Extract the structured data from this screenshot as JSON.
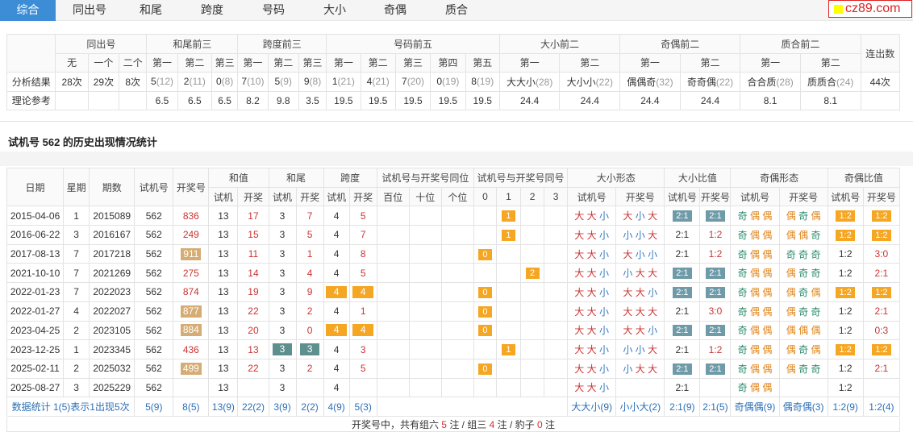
{
  "tabs": [
    "综合",
    "同出号",
    "和尾",
    "跨度",
    "号码",
    "大小",
    "奇偶",
    "质合"
  ],
  "logo": "cz89.com",
  "summary": {
    "groups": [
      "同出号",
      "和尾前三",
      "跨度前三",
      "号码前五",
      "大小前二",
      "奇偶前二",
      "质合前二",
      "连出数"
    ],
    "sub": [
      "无",
      "一个",
      "二个",
      "第一",
      "第二",
      "第三",
      "第一",
      "第二",
      "第三",
      "第一",
      "第二",
      "第三",
      "第四",
      "第五",
      "第一",
      "第二",
      "第一",
      "第二",
      "第一",
      "第二"
    ],
    "row1_label": "分析结果",
    "row1": [
      [
        "28次",
        ""
      ],
      [
        "29次",
        ""
      ],
      [
        "8次",
        ""
      ],
      [
        "5",
        "(12)"
      ],
      [
        "2",
        "(11)"
      ],
      [
        "0",
        "(8)"
      ],
      [
        "7",
        "(10)"
      ],
      [
        "5",
        "(9)"
      ],
      [
        "9",
        "(8)"
      ],
      [
        "1",
        "(21)"
      ],
      [
        "4",
        "(21)"
      ],
      [
        "7",
        "(20)"
      ],
      [
        "0",
        "(19)"
      ],
      [
        "8",
        "(19)"
      ],
      [
        "大大小",
        "(28)"
      ],
      [
        "大小小",
        "(22)"
      ],
      [
        "偶偶奇",
        "(32)"
      ],
      [
        "奇奇偶",
        "(22)"
      ],
      [
        "合合质",
        "(28)"
      ],
      [
        "质质合",
        "(24)"
      ],
      [
        "44次",
        ""
      ]
    ],
    "row2_label": "理论参考",
    "row2": [
      "",
      "",
      "",
      "6.5",
      "6.5",
      "6.5",
      "8.2",
      "9.8",
      "3.5",
      "19.5",
      "19.5",
      "19.5",
      "19.5",
      "19.5",
      "24.4",
      "24.4",
      "24.4",
      "24.4",
      "8.1",
      "8.1",
      ""
    ]
  },
  "section_title": "试机号 562 的历史出现情况统计",
  "hist": {
    "h_date": "日期",
    "h_week": "星期",
    "h_issue": "期数",
    "h_test": "试机号",
    "h_draw": "开奖号",
    "groups": [
      "和值",
      "和尾",
      "跨度",
      "试机号与开奖号同位",
      "试机号与开奖号同号",
      "大小形态",
      "大小比值",
      "奇偶形态",
      "奇偶比值"
    ],
    "sub": [
      "试机",
      "开奖",
      "试机",
      "开奖",
      "试机",
      "开奖",
      "百位",
      "十位",
      "个位",
      "0",
      "1",
      "2",
      "3",
      "试机号",
      "开奖号",
      "试机号",
      "开奖号",
      "试机号",
      "开奖号",
      "试机号",
      "开奖号"
    ],
    "rows": [
      {
        "date": "2015-04-06",
        "week": "1",
        "issue": "2015089",
        "test": "562",
        "draw": "836",
        "dstyle": "plain",
        "sum_t": "13",
        "sum_d": "17",
        "tail_t": "3",
        "tail_d": "7",
        "tailhl": false,
        "span_t": "4",
        "span_d": "5",
        "spanhl": false,
        "same": "1",
        "bs_t": [
          "大",
          "大",
          "小"
        ],
        "bs_d": [
          "大",
          "小",
          "大"
        ],
        "bsr_t": "2:1",
        "bsr_d": "2:1",
        "bsr_thl": true,
        "bsr_dhl": true,
        "oe_t": [
          "奇",
          "偶",
          "偶"
        ],
        "oe_d": [
          "偶",
          "奇",
          "偶"
        ],
        "oer_t": "1:2",
        "oer_d": "1:2",
        "oer_thl": true,
        "oer_dhl": true
      },
      {
        "date": "2016-06-22",
        "week": "3",
        "issue": "2016167",
        "test": "562",
        "draw": "249",
        "dstyle": "plain",
        "sum_t": "13",
        "sum_d": "15",
        "tail_t": "3",
        "tail_d": "5",
        "tailhl": false,
        "span_t": "4",
        "span_d": "7",
        "spanhl": false,
        "same": "1",
        "bs_t": [
          "大",
          "大",
          "小"
        ],
        "bs_d": [
          "小",
          "小",
          "大"
        ],
        "bsr_t": "2:1",
        "bsr_d": "1:2",
        "bsr_thl": false,
        "bsr_dhl": false,
        "oe_t": [
          "奇",
          "偶",
          "偶"
        ],
        "oe_d": [
          "偶",
          "偶",
          "奇"
        ],
        "oer_t": "1:2",
        "oer_d": "1:2",
        "oer_thl": true,
        "oer_dhl": true
      },
      {
        "date": "2017-08-13",
        "week": "7",
        "issue": "2017218",
        "test": "562",
        "draw": "911",
        "dstyle": "tan",
        "sum_t": "13",
        "sum_d": "11",
        "tail_t": "3",
        "tail_d": "1",
        "tailhl": false,
        "span_t": "4",
        "span_d": "8",
        "spanhl": false,
        "same": "0",
        "bs_t": [
          "大",
          "大",
          "小"
        ],
        "bs_d": [
          "大",
          "小",
          "小"
        ],
        "bsr_t": "2:1",
        "bsr_d": "1:2",
        "bsr_thl": false,
        "bsr_dhl": false,
        "oe_t": [
          "奇",
          "偶",
          "偶"
        ],
        "oe_d": [
          "奇",
          "奇",
          "奇"
        ],
        "oer_t": "1:2",
        "oer_d": "3:0",
        "oer_thl": false,
        "oer_dhl": false
      },
      {
        "date": "2021-10-10",
        "week": "7",
        "issue": "2021269",
        "test": "562",
        "draw": "275",
        "dstyle": "plain",
        "sum_t": "13",
        "sum_d": "14",
        "tail_t": "3",
        "tail_d": "4",
        "tailhl": false,
        "span_t": "4",
        "span_d": "5",
        "spanhl": false,
        "same": "2",
        "bs_t": [
          "大",
          "大",
          "小"
        ],
        "bs_d": [
          "小",
          "大",
          "大"
        ],
        "bsr_t": "2:1",
        "bsr_d": "2:1",
        "bsr_thl": true,
        "bsr_dhl": true,
        "oe_t": [
          "奇",
          "偶",
          "偶"
        ],
        "oe_d": [
          "偶",
          "奇",
          "奇"
        ],
        "oer_t": "1:2",
        "oer_d": "2:1",
        "oer_thl": false,
        "oer_dhl": false
      },
      {
        "date": "2022-01-23",
        "week": "7",
        "issue": "2022023",
        "test": "562",
        "draw": "874",
        "dstyle": "plain",
        "sum_t": "13",
        "sum_d": "19",
        "tail_t": "3",
        "tail_d": "9",
        "tailhl": false,
        "span_t": "4",
        "span_d": "4",
        "spanhl": true,
        "same": "0",
        "bs_t": [
          "大",
          "大",
          "小"
        ],
        "bs_d": [
          "大",
          "大",
          "小"
        ],
        "bsr_t": "2:1",
        "bsr_d": "2:1",
        "bsr_thl": true,
        "bsr_dhl": true,
        "oe_t": [
          "奇",
          "偶",
          "偶"
        ],
        "oe_d": [
          "偶",
          "奇",
          "偶"
        ],
        "oer_t": "1:2",
        "oer_d": "1:2",
        "oer_thl": true,
        "oer_dhl": true
      },
      {
        "date": "2022-01-27",
        "week": "4",
        "issue": "2022027",
        "test": "562",
        "draw": "877",
        "dstyle": "tan",
        "sum_t": "13",
        "sum_d": "22",
        "tail_t": "3",
        "tail_d": "2",
        "tailhl": false,
        "span_t": "4",
        "span_d": "1",
        "spanhl": false,
        "same": "0",
        "bs_t": [
          "大",
          "大",
          "小"
        ],
        "bs_d": [
          "大",
          "大",
          "大"
        ],
        "bsr_t": "2:1",
        "bsr_d": "3:0",
        "bsr_thl": false,
        "bsr_dhl": false,
        "oe_t": [
          "奇",
          "偶",
          "偶"
        ],
        "oe_d": [
          "偶",
          "奇",
          "奇"
        ],
        "oer_t": "1:2",
        "oer_d": "2:1",
        "oer_thl": false,
        "oer_dhl": false
      },
      {
        "date": "2023-04-25",
        "week": "2",
        "issue": "2023105",
        "test": "562",
        "draw": "884",
        "dstyle": "tan",
        "sum_t": "13",
        "sum_d": "20",
        "tail_t": "3",
        "tail_d": "0",
        "tailhl": false,
        "span_t": "4",
        "span_d": "4",
        "spanhl": true,
        "same": "0",
        "bs_t": [
          "大",
          "大",
          "小"
        ],
        "bs_d": [
          "大",
          "大",
          "小"
        ],
        "bsr_t": "2:1",
        "bsr_d": "2:1",
        "bsr_thl": true,
        "bsr_dhl": true,
        "oe_t": [
          "奇",
          "偶",
          "偶"
        ],
        "oe_d": [
          "偶",
          "偶",
          "偶"
        ],
        "oer_t": "1:2",
        "oer_d": "0:3",
        "oer_thl": false,
        "oer_dhl": false
      },
      {
        "date": "2023-12-25",
        "week": "1",
        "issue": "2023345",
        "test": "562",
        "draw": "436",
        "dstyle": "plain",
        "sum_t": "13",
        "sum_d": "13",
        "tail_t": "3",
        "tail_d": "3",
        "tailhl": true,
        "span_t": "4",
        "span_d": "3",
        "spanhl": false,
        "same": "1",
        "bs_t": [
          "大",
          "大",
          "小"
        ],
        "bs_d": [
          "小",
          "小",
          "大"
        ],
        "bsr_t": "2:1",
        "bsr_d": "1:2",
        "bsr_thl": false,
        "bsr_dhl": false,
        "oe_t": [
          "奇",
          "偶",
          "偶"
        ],
        "oe_d": [
          "偶",
          "奇",
          "偶"
        ],
        "oer_t": "1:2",
        "oer_d": "1:2",
        "oer_thl": true,
        "oer_dhl": true
      },
      {
        "date": "2025-02-11",
        "week": "2",
        "issue": "2025032",
        "test": "562",
        "draw": "499",
        "dstyle": "tan",
        "sum_t": "13",
        "sum_d": "22",
        "tail_t": "3",
        "tail_d": "2",
        "tailhl": false,
        "span_t": "4",
        "span_d": "5",
        "spanhl": false,
        "same": "0",
        "bs_t": [
          "大",
          "大",
          "小"
        ],
        "bs_d": [
          "小",
          "大",
          "大"
        ],
        "bsr_t": "2:1",
        "bsr_d": "2:1",
        "bsr_thl": true,
        "bsr_dhl": true,
        "oe_t": [
          "奇",
          "偶",
          "偶"
        ],
        "oe_d": [
          "偶",
          "奇",
          "奇"
        ],
        "oer_t": "1:2",
        "oer_d": "2:1",
        "oer_thl": false,
        "oer_dhl": false
      },
      {
        "date": "2025-08-27",
        "week": "3",
        "issue": "2025229",
        "test": "562",
        "draw": "",
        "dstyle": "plain",
        "sum_t": "13",
        "sum_d": "",
        "tail_t": "3",
        "tail_d": "",
        "tailhl": false,
        "span_t": "4",
        "span_d": "",
        "spanhl": false,
        "same": "",
        "bs_t": [
          "大",
          "大",
          "小"
        ],
        "bs_d": [],
        "bsr_t": "2:1",
        "bsr_d": "",
        "bsr_thl": false,
        "bsr_dhl": false,
        "oe_t": [
          "奇",
          "偶",
          "偶"
        ],
        "oe_d": [],
        "oer_t": "1:2",
        "oer_d": "",
        "oer_thl": false,
        "oer_dhl": false
      }
    ],
    "stats": {
      "label": "数据统计",
      "desc": "1(5)表示1出现5次",
      "test": "5(9)",
      "draw": "8(5)",
      "sum_t": "13(9)",
      "sum_d": "22(2)",
      "tail_t": "3(9)",
      "tail_d": "2(2)",
      "span_t": "4(9)",
      "span_d": "5(3)",
      "bs_t": "大大小(9)",
      "bs_d": "小小大(2)",
      "bsr_t": "2:1(9)",
      "bsr_d": "2:1(5)",
      "oe_t": "奇偶偶(9)",
      "oe_d": "偶奇偶(3)",
      "oer_t": "1:2(9)",
      "oer_d": "1:2(4)"
    }
  },
  "summary_line": {
    "pre": "开奖号中，共有组六 ",
    "n6": "5",
    "mid1": " 注 / 组三 ",
    "n3": "4",
    "mid2": " 注 / 豹子 ",
    "nb": "0",
    "post": " 注"
  }
}
